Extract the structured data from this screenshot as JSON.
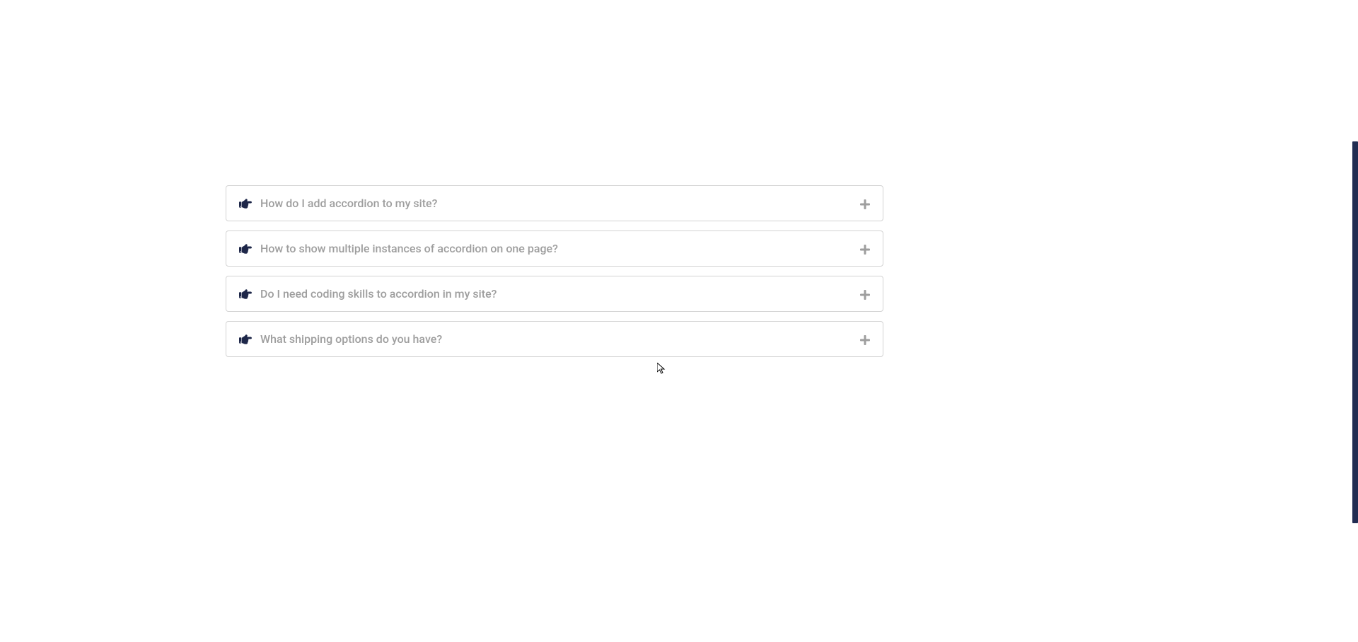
{
  "accordion": {
    "items": [
      {
        "title": "How do I add accordion to my site?"
      },
      {
        "title": "How to show multiple instances of accordion on one page?"
      },
      {
        "title": "Do I need coding skills to accordion in my site?"
      },
      {
        "title": "What shipping options do you have?"
      }
    ]
  }
}
